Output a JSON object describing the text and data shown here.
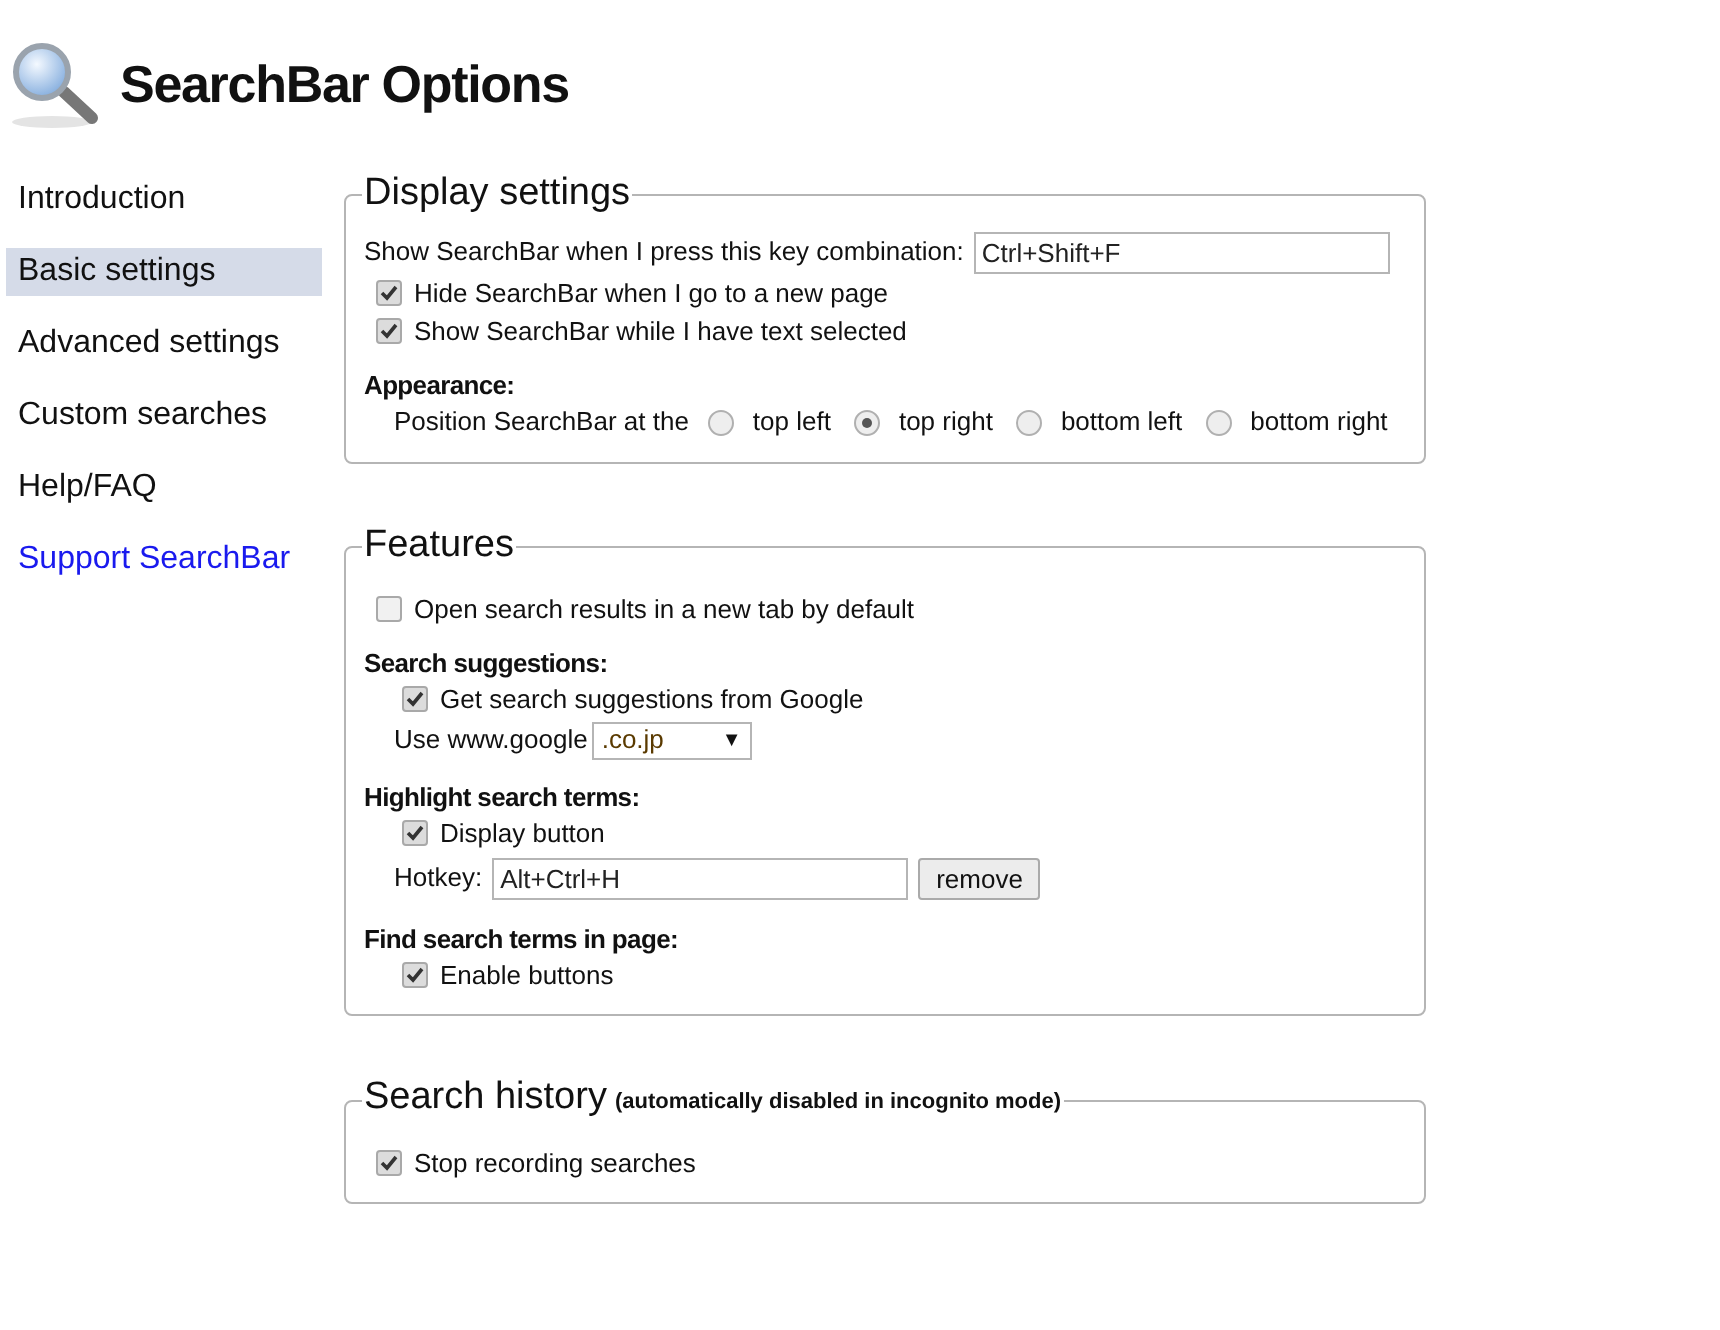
{
  "header": {
    "title": "SearchBar Options"
  },
  "sidebar": {
    "items": [
      {
        "label": "Introduction",
        "selected": false,
        "kind": "nav"
      },
      {
        "label": "Basic settings",
        "selected": true,
        "kind": "nav"
      },
      {
        "label": "Advanced settings",
        "selected": false,
        "kind": "nav"
      },
      {
        "label": "Custom searches",
        "selected": false,
        "kind": "nav"
      },
      {
        "label": "Help/FAQ",
        "selected": false,
        "kind": "nav"
      },
      {
        "label": "Support SearchBar",
        "selected": false,
        "kind": "link"
      }
    ]
  },
  "sections": [
    {
      "title": "Display settings",
      "rows": [
        {
          "kind": "field",
          "label": "Show SearchBar when I press this key combination:",
          "value": "Ctrl+Shift+F"
        },
        {
          "kind": "checkbox",
          "label": "Hide SearchBar when I go to a new page",
          "checked": true
        },
        {
          "kind": "checkbox",
          "label": "Show SearchBar while I have text selected",
          "checked": true
        },
        {
          "kind": "heading",
          "label": "Appearance:",
          "children": [
            {
              "kind": "radios",
              "label": "Position SearchBar at the",
              "options": [
                {
                  "label": "top left",
                  "selected": false
                },
                {
                  "label": "top right",
                  "selected": true
                },
                {
                  "label": "bottom left",
                  "selected": false
                },
                {
                  "label": "bottom right",
                  "selected": false
                }
              ]
            }
          ]
        }
      ]
    },
    {
      "title": "Features",
      "rows": [
        {
          "kind": "checkbox",
          "label": "Open search results in a new tab by default",
          "checked": false
        },
        {
          "kind": "heading",
          "label": "Search suggestions:",
          "children": [
            {
              "kind": "checkbox",
              "label": "Get search suggestions from Google",
              "checked": true
            },
            {
              "kind": "select",
              "label": "Use www.google",
              "value": ".co.jp",
              "arrow": "▼"
            }
          ]
        },
        {
          "kind": "heading",
          "label": "Highlight search terms:",
          "children": [
            {
              "kind": "checkbox",
              "label": "Display button",
              "checked": true
            },
            {
              "kind": "field_button",
              "label": "Hotkey:",
              "value": "Alt+Ctrl+H",
              "button": "remove"
            }
          ]
        },
        {
          "kind": "heading",
          "label": "Find search terms in page:",
          "children": [
            {
              "kind": "checkbox",
              "label": "Enable buttons",
              "checked": true
            }
          ]
        }
      ]
    },
    {
      "title": "Search history",
      "note": "(automatically disabled in incognito mode)",
      "rows": [
        {
          "kind": "checkbox",
          "label": "Stop recording searches",
          "checked": true
        }
      ]
    }
  ]
}
